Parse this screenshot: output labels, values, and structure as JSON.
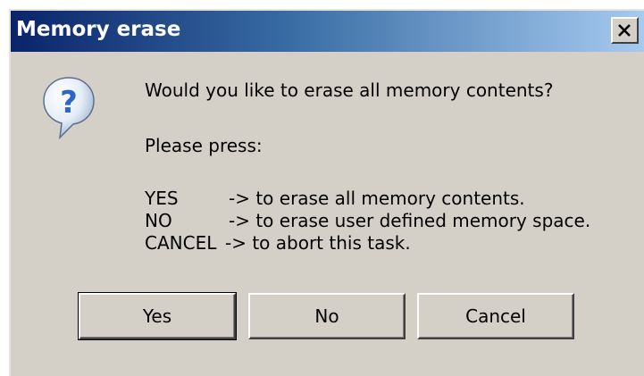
{
  "window": {
    "title": "Memory erase",
    "close_icon": "close-icon"
  },
  "icon": "question-icon",
  "message": {
    "question": "Would you like to erase all memory contents?",
    "instruction": "Please press:",
    "options": [
      {
        "key": "YES",
        "description": "-> to erase all memory contents."
      },
      {
        "key": "NO",
        "description": "-> to erase user defined memory space."
      },
      {
        "key": "CANCEL",
        "description": "-> to abort this task."
      }
    ]
  },
  "buttons": {
    "yes_label": "Yes",
    "no_label": "No",
    "cancel_label": "Cancel"
  },
  "colors": {
    "dialog_bg": "#d4d0c8",
    "titlebar_start": "#0a246a",
    "titlebar_end": "#a6caf0",
    "icon_blue": "#2d66c4"
  }
}
